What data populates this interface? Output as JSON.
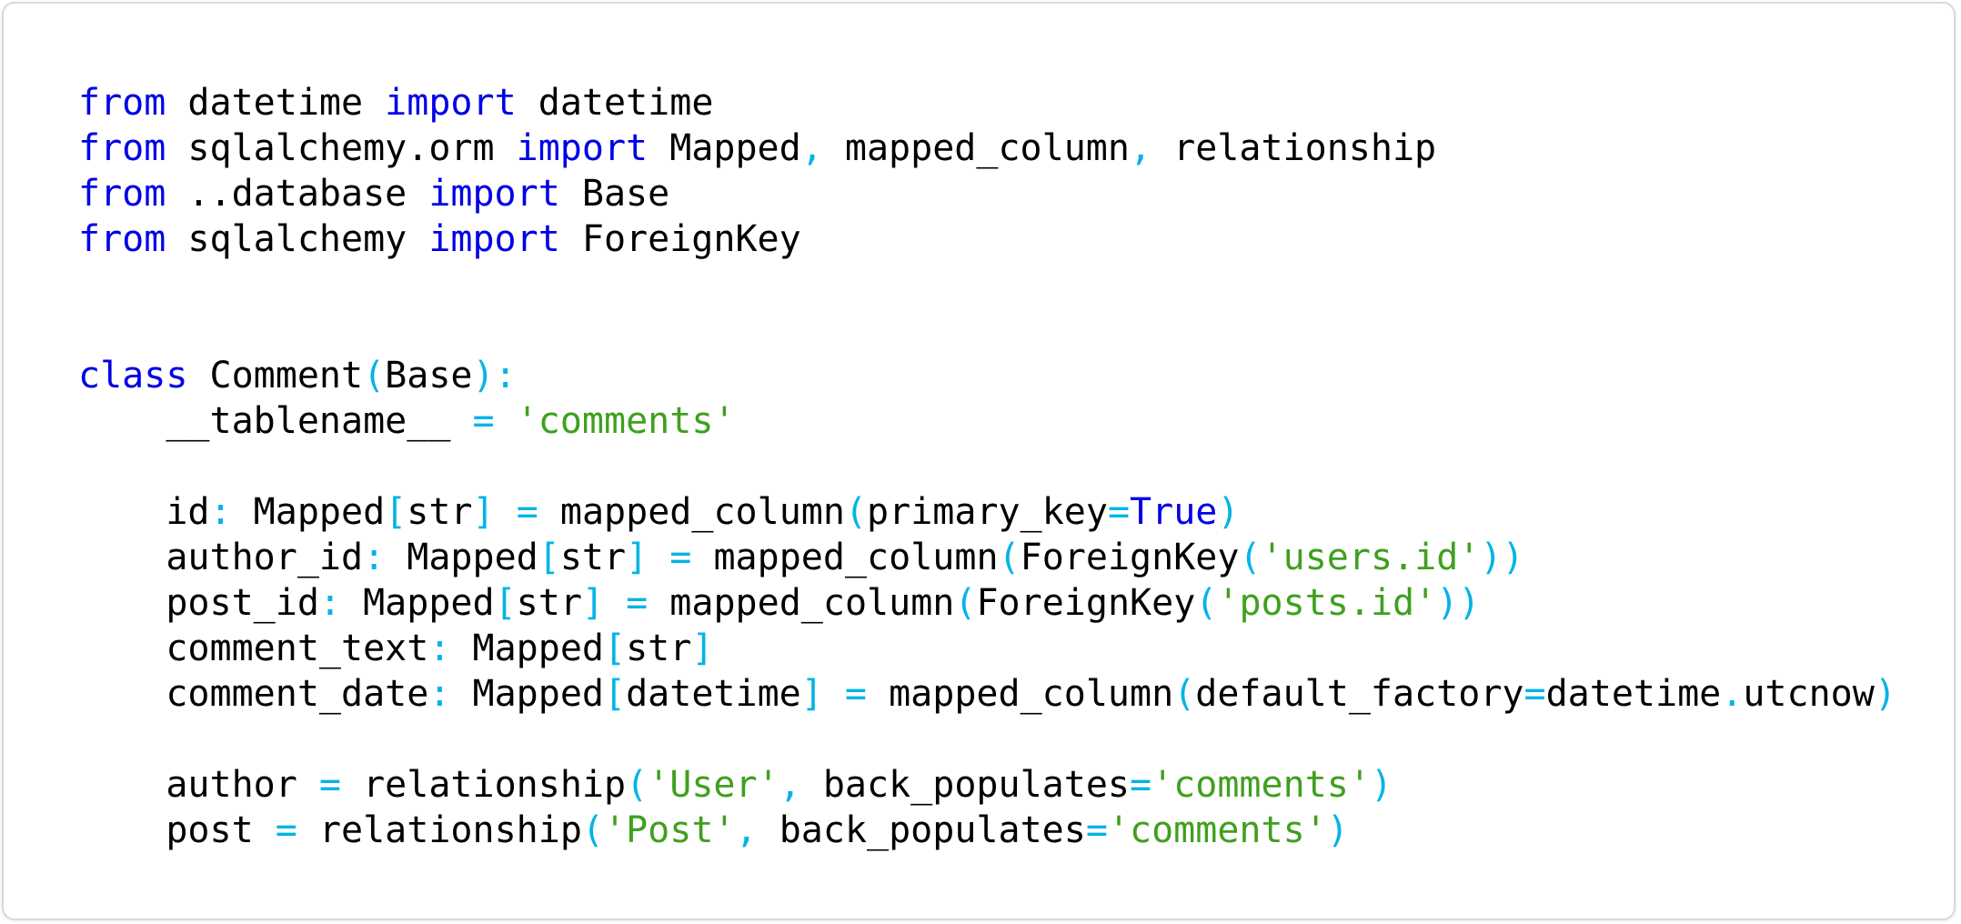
{
  "colors": {
    "keyword": "#0000e6",
    "punctuation": "#00b4e6",
    "string": "#3fa01e",
    "text": "#000000",
    "border": "#d9d9d9",
    "background": "#ffffff"
  },
  "code_lines": [
    [
      {
        "t": "kw",
        "v": "from"
      },
      {
        "t": "t",
        "v": " datetime "
      },
      {
        "t": "kw",
        "v": "import"
      },
      {
        "t": "t",
        "v": " datetime"
      }
    ],
    [
      {
        "t": "kw",
        "v": "from"
      },
      {
        "t": "t",
        "v": " sqlalchemy.orm "
      },
      {
        "t": "kw",
        "v": "import"
      },
      {
        "t": "t",
        "v": " Mapped"
      },
      {
        "t": "p",
        "v": ","
      },
      {
        "t": "t",
        "v": " mapped_column"
      },
      {
        "t": "p",
        "v": ","
      },
      {
        "t": "t",
        "v": " relationship"
      }
    ],
    [
      {
        "t": "kw",
        "v": "from"
      },
      {
        "t": "t",
        "v": " ..database "
      },
      {
        "t": "kw",
        "v": "import"
      },
      {
        "t": "t",
        "v": " Base"
      }
    ],
    [
      {
        "t": "kw",
        "v": "from"
      },
      {
        "t": "t",
        "v": " sqlalchemy "
      },
      {
        "t": "kw",
        "v": "import"
      },
      {
        "t": "t",
        "v": " ForeignKey"
      }
    ],
    [],
    [],
    [
      {
        "t": "kw",
        "v": "class"
      },
      {
        "t": "t",
        "v": " Comment"
      },
      {
        "t": "p",
        "v": "("
      },
      {
        "t": "t",
        "v": "Base"
      },
      {
        "t": "p",
        "v": "):"
      }
    ],
    [
      {
        "t": "t",
        "v": "    __tablename__ "
      },
      {
        "t": "p",
        "v": "="
      },
      {
        "t": "t",
        "v": " "
      },
      {
        "t": "s",
        "v": "'comments'"
      }
    ],
    [],
    [
      {
        "t": "t",
        "v": "    id"
      },
      {
        "t": "p",
        "v": ":"
      },
      {
        "t": "t",
        "v": " Mapped"
      },
      {
        "t": "p",
        "v": "["
      },
      {
        "t": "t",
        "v": "str"
      },
      {
        "t": "p",
        "v": "]"
      },
      {
        "t": "t",
        "v": " "
      },
      {
        "t": "p",
        "v": "="
      },
      {
        "t": "t",
        "v": " mapped_column"
      },
      {
        "t": "p",
        "v": "("
      },
      {
        "t": "t",
        "v": "primary_key"
      },
      {
        "t": "p",
        "v": "="
      },
      {
        "t": "kw",
        "v": "True"
      },
      {
        "t": "p",
        "v": ")"
      }
    ],
    [
      {
        "t": "t",
        "v": "    author_id"
      },
      {
        "t": "p",
        "v": ":"
      },
      {
        "t": "t",
        "v": " Mapped"
      },
      {
        "t": "p",
        "v": "["
      },
      {
        "t": "t",
        "v": "str"
      },
      {
        "t": "p",
        "v": "]"
      },
      {
        "t": "t",
        "v": " "
      },
      {
        "t": "p",
        "v": "="
      },
      {
        "t": "t",
        "v": " mapped_column"
      },
      {
        "t": "p",
        "v": "("
      },
      {
        "t": "t",
        "v": "ForeignKey"
      },
      {
        "t": "p",
        "v": "("
      },
      {
        "t": "s",
        "v": "'users.id'"
      },
      {
        "t": "p",
        "v": "))"
      }
    ],
    [
      {
        "t": "t",
        "v": "    post_id"
      },
      {
        "t": "p",
        "v": ":"
      },
      {
        "t": "t",
        "v": " Mapped"
      },
      {
        "t": "p",
        "v": "["
      },
      {
        "t": "t",
        "v": "str"
      },
      {
        "t": "p",
        "v": "]"
      },
      {
        "t": "t",
        "v": " "
      },
      {
        "t": "p",
        "v": "="
      },
      {
        "t": "t",
        "v": " mapped_column"
      },
      {
        "t": "p",
        "v": "("
      },
      {
        "t": "t",
        "v": "ForeignKey"
      },
      {
        "t": "p",
        "v": "("
      },
      {
        "t": "s",
        "v": "'posts.id'"
      },
      {
        "t": "p",
        "v": "))"
      }
    ],
    [
      {
        "t": "t",
        "v": "    comment_text"
      },
      {
        "t": "p",
        "v": ":"
      },
      {
        "t": "t",
        "v": " Mapped"
      },
      {
        "t": "p",
        "v": "["
      },
      {
        "t": "t",
        "v": "str"
      },
      {
        "t": "p",
        "v": "]"
      }
    ],
    [
      {
        "t": "t",
        "v": "    comment_date"
      },
      {
        "t": "p",
        "v": ":"
      },
      {
        "t": "t",
        "v": " Mapped"
      },
      {
        "t": "p",
        "v": "["
      },
      {
        "t": "t",
        "v": "datetime"
      },
      {
        "t": "p",
        "v": "]"
      },
      {
        "t": "t",
        "v": " "
      },
      {
        "t": "p",
        "v": "="
      },
      {
        "t": "t",
        "v": " mapped_column"
      },
      {
        "t": "p",
        "v": "("
      },
      {
        "t": "t",
        "v": "default_factory"
      },
      {
        "t": "p",
        "v": "="
      },
      {
        "t": "t",
        "v": "datetime"
      },
      {
        "t": "p",
        "v": "."
      },
      {
        "t": "t",
        "v": "utcnow"
      },
      {
        "t": "p",
        "v": ")"
      }
    ],
    [],
    [
      {
        "t": "t",
        "v": "    author "
      },
      {
        "t": "p",
        "v": "="
      },
      {
        "t": "t",
        "v": " relationship"
      },
      {
        "t": "p",
        "v": "("
      },
      {
        "t": "s",
        "v": "'User'"
      },
      {
        "t": "p",
        "v": ","
      },
      {
        "t": "t",
        "v": " back_populates"
      },
      {
        "t": "p",
        "v": "="
      },
      {
        "t": "s",
        "v": "'comments'"
      },
      {
        "t": "p",
        "v": ")"
      }
    ],
    [
      {
        "t": "t",
        "v": "    post "
      },
      {
        "t": "p",
        "v": "="
      },
      {
        "t": "t",
        "v": " relationship"
      },
      {
        "t": "p",
        "v": "("
      },
      {
        "t": "s",
        "v": "'Post'"
      },
      {
        "t": "p",
        "v": ","
      },
      {
        "t": "t",
        "v": " back_populates"
      },
      {
        "t": "p",
        "v": "="
      },
      {
        "t": "s",
        "v": "'comments'"
      },
      {
        "t": "p",
        "v": ")"
      }
    ]
  ]
}
